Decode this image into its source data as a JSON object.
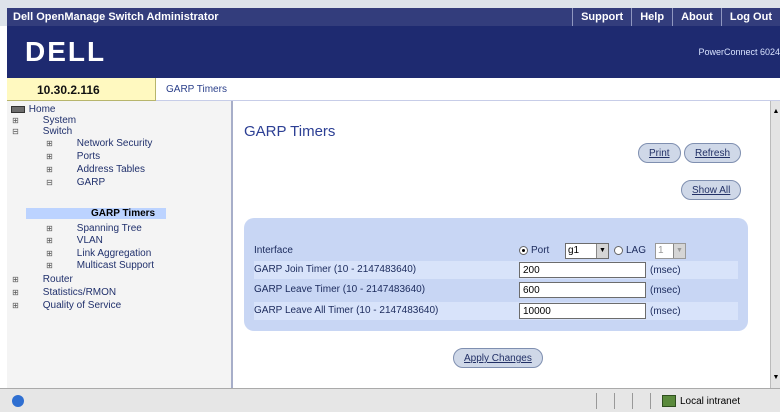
{
  "header": {
    "app_title": "Dell OpenManage Switch Administrator",
    "links": [
      "Support",
      "Help",
      "About",
      "Log Out"
    ],
    "logo_text": "DELL",
    "model": "PowerConnect 6024"
  },
  "ip": "10.30.2.116",
  "breadcrumb": "GARP Timers",
  "tree": [
    {
      "label": "Home",
      "level": 0,
      "toggle": "",
      "icon": "drive-icon"
    },
    {
      "label": "System",
      "level": 1,
      "toggle": "⊞"
    },
    {
      "label": "Switch",
      "level": 1,
      "toggle": "⊟"
    },
    {
      "label": "Network Security",
      "level": 2,
      "toggle": "⊞"
    },
    {
      "label": "Ports",
      "level": 2,
      "toggle": "⊞"
    },
    {
      "label": "Address Tables",
      "level": 2,
      "toggle": "⊞"
    },
    {
      "label": "GARP",
      "level": 2,
      "toggle": "⊟"
    },
    {
      "label": "GARP Timers",
      "level": 3,
      "toggle": "",
      "selected": true
    },
    {
      "label": "Spanning Tree",
      "level": 2,
      "toggle": "⊞"
    },
    {
      "label": "VLAN",
      "level": 2,
      "toggle": "⊞"
    },
    {
      "label": "Link Aggregation",
      "level": 2,
      "toggle": "⊞"
    },
    {
      "label": "Multicast Support",
      "level": 2,
      "toggle": "⊞"
    },
    {
      "label": "Router",
      "level": 1,
      "toggle": "⊞"
    },
    {
      "label": "Statistics/RMON",
      "level": 1,
      "toggle": "⊞"
    },
    {
      "label": "Quality of Service",
      "level": 1,
      "toggle": "⊞"
    }
  ],
  "main": {
    "title": "GARP Timers",
    "buttons": {
      "print": "Print",
      "refresh": "Refresh",
      "show_all": "Show All",
      "apply": "Apply Changes"
    },
    "interface": {
      "label": "Interface",
      "port_label": "Port",
      "port_value": "g1",
      "lag_label": "LAG",
      "lag_value": "1",
      "selected": "port"
    },
    "fields": [
      {
        "label": "GARP Join Timer (10 - 2147483640)",
        "value": "200",
        "unit": "(msec)"
      },
      {
        "label": "GARP Leave Timer (10 - 2147483640)",
        "value": "600",
        "unit": "(msec)"
      },
      {
        "label": "GARP Leave All Timer (10 - 2147483640)",
        "value": "10000",
        "unit": "(msec)"
      }
    ]
  },
  "statusbar": {
    "zone": "Local intranet"
  },
  "colors": {
    "nav_bar": "#333d7c",
    "brand_bar": "#1e2a70",
    "panel": "#c8d6f4",
    "ip_cell": "#fff9c0"
  }
}
